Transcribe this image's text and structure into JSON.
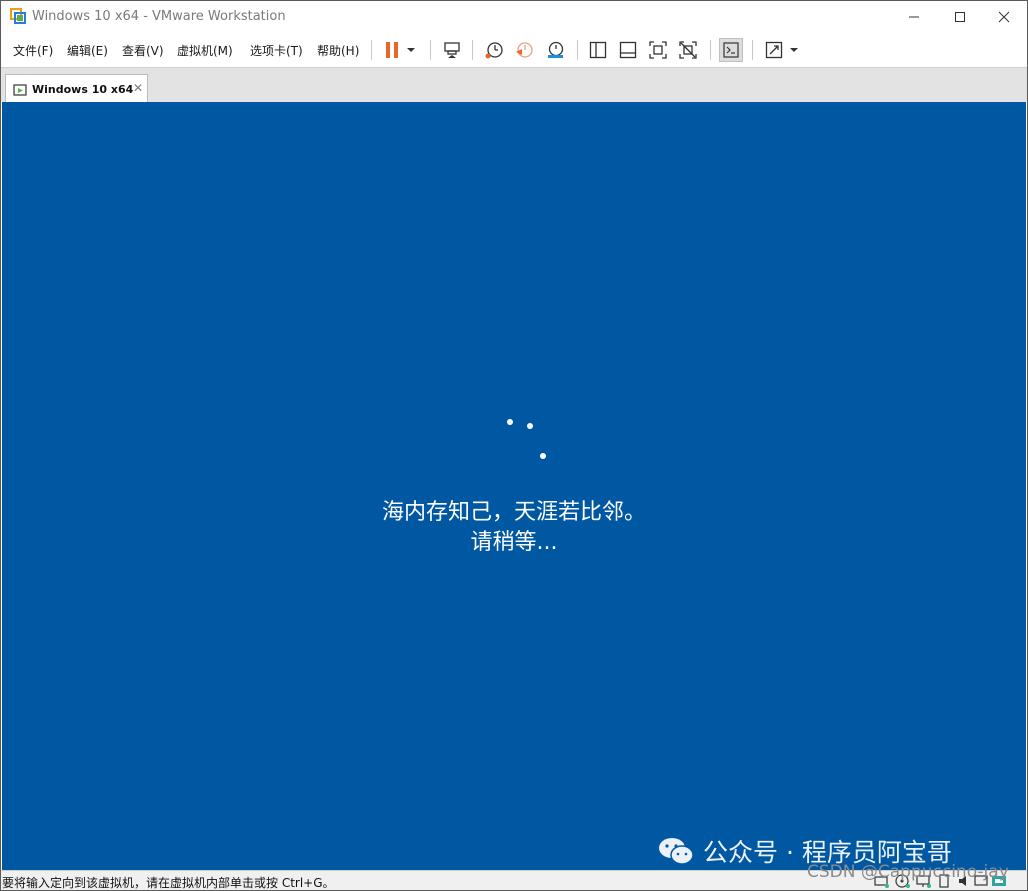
{
  "window": {
    "title": "Windows 10 x64 - VMware Workstation",
    "app_icon": "vmware-icon",
    "controls": {
      "minimize": "—",
      "maximize": "☐",
      "close": "✕"
    }
  },
  "menu": {
    "items": [
      {
        "label": "文件(F)"
      },
      {
        "label": "编辑(E)"
      },
      {
        "label": "查看(V)"
      },
      {
        "label": "虚拟机(M)"
      },
      {
        "label": "选项卡(T)"
      },
      {
        "label": "帮助(H)"
      }
    ]
  },
  "toolbar": {
    "icons": [
      "pause-icon",
      "dropdown-arrow-icon",
      "send-ctrl-alt-del-icon",
      "snapshot-icon",
      "revert-snapshot-icon",
      "snapshot-manager-icon",
      "show-library-icon",
      "show-thumbnail-icon",
      "full-screen-icon",
      "unity-icon",
      "console-view-icon",
      "stretch-icon",
      "dropdown-arrow-icon"
    ],
    "accent_pause": "#e8652b"
  },
  "tabs": [
    {
      "label": "Windows 10 x64",
      "close": "✕",
      "active": true
    }
  ],
  "guest": {
    "background": "#0058a2",
    "line1": "海内存知己，天涯若比邻。",
    "line2": "请稍等..."
  },
  "watermark": {
    "text": "公众号 · 程序员阿宝哥",
    "icon": "wechat-icon"
  },
  "status": {
    "message": "要将输入定向到该虚拟机，请在虚拟机内部单击或按 Ctrl+G。",
    "csdn": "CSDN @Cappuccino-jay",
    "device_icons": [
      "hard-disk-icon",
      "cd-drive-icon",
      "network-icon",
      "usb-icon",
      "printer-icon",
      "sound-icon",
      "display-icon",
      "vm-message-icon"
    ]
  }
}
